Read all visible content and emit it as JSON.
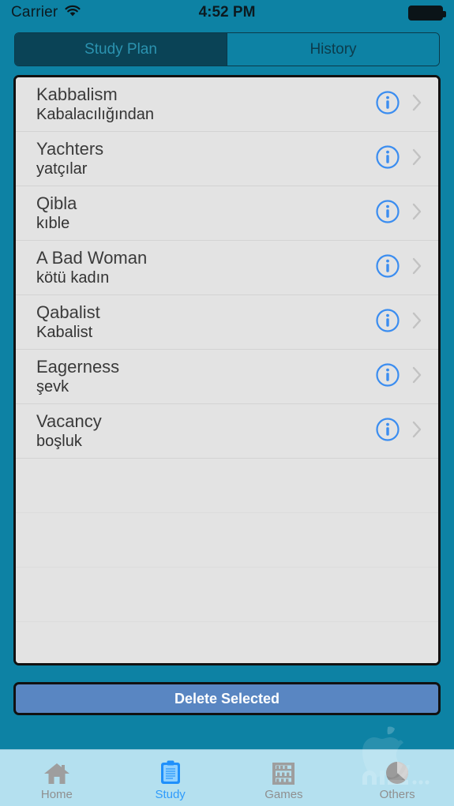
{
  "status_bar": {
    "carrier": "Carrier",
    "wifi_icon": "wifi-icon",
    "time": "4:52 PM",
    "battery_icon": "battery-full-icon"
  },
  "segmented_control": {
    "selected_index": 0,
    "segments": [
      {
        "label": "Study Plan",
        "selected": true
      },
      {
        "label": "History",
        "selected": false
      }
    ]
  },
  "list": {
    "accessory_info_icon": "info-circle-icon",
    "accessory_chevron_icon": "chevron-right-icon",
    "items": [
      {
        "word": "Kabbalism",
        "translation": "Kabalacılığından"
      },
      {
        "word": "Yachters",
        "translation": "yatçılar"
      },
      {
        "word": "Qibla",
        "translation": "kıble"
      },
      {
        "word": "A Bad Woman",
        "translation": "kötü kadın"
      },
      {
        "word": "Qabalist",
        "translation": "Kabalist"
      },
      {
        "word": "Eagerness",
        "translation": "şevk"
      },
      {
        "word": "Vacancy",
        "translation": "boşluk"
      }
    ],
    "empty_row_count": 4
  },
  "delete_button": {
    "label": "Delete Selected"
  },
  "tab_bar": {
    "active_index": 1,
    "tabs": [
      {
        "label": "Home",
        "icon": "house-icon",
        "active": false
      },
      {
        "label": "Study",
        "icon": "clipboard-icon",
        "active": true
      },
      {
        "label": "Games",
        "icon": "abacus-icon",
        "active": false
      },
      {
        "label": "Others",
        "icon": "pie-chart-icon",
        "active": false
      }
    ]
  },
  "watermark": {
    "icon": "apple-logo-watermark"
  },
  "colors": {
    "background_teal": "#0d82a4",
    "segment_selected": "#0a4356",
    "segment_selected_text": "#2b93b0",
    "segment_text": "#0d3c4c",
    "list_background": "#e3e3e3",
    "list_border": "#111111",
    "row_word_text": "#3b3b3b",
    "delete_button_fill": "#5986c2",
    "delete_button_text": "#ffffff",
    "tab_bar_background": "#b4e0ef",
    "tab_active": "#2f9bfb",
    "tab_inactive": "#8f8f8f",
    "info_icon_blue": "#3b8df0"
  }
}
